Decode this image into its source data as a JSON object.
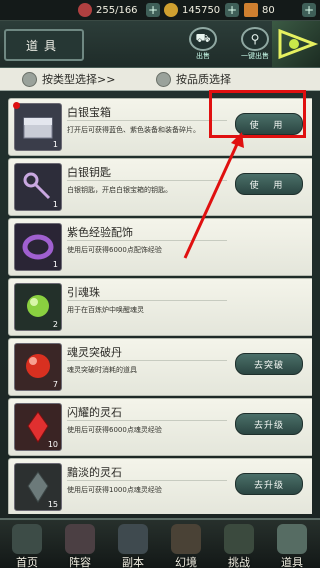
{
  "status": {
    "stamina": "255/166",
    "coins": "145750",
    "gems": "80"
  },
  "header": {
    "title": "道具",
    "sell_label": "出售",
    "batch_sell_label": "一键出售"
  },
  "filters": {
    "by_type": "按类型选择>>",
    "by_quality": "按品质选择"
  },
  "items": [
    {
      "name": "白银宝箱",
      "desc": "打开后可获得蓝色、紫色装备和装备碎片。",
      "qty": "1",
      "action": "使 用",
      "has_button": true
    },
    {
      "name": "白银钥匙",
      "desc": "白银钥匙，开启白银宝箱的钥匙。",
      "qty": "1",
      "action": "使 用",
      "has_button": true
    },
    {
      "name": "紫色经验配饰",
      "desc": "使用后可获得6000点配饰经验",
      "qty": "1",
      "action": "",
      "has_button": false
    },
    {
      "name": "引魂珠",
      "desc": "用于在百炼炉中唤醒魂灵",
      "qty": "2",
      "action": "",
      "has_button": false
    },
    {
      "name": "魂灵突破丹",
      "desc": "魂灵突破时消耗的道具",
      "qty": "7",
      "action": "去突破",
      "has_button": true
    },
    {
      "name": "闪耀的灵石",
      "desc": "使用后可获得6000点魂灵经验",
      "qty": "10",
      "action": "去升级",
      "has_button": true
    },
    {
      "name": "黯淡的灵石",
      "desc": "使用后可获得1000点魂灵经验",
      "qty": "15",
      "action": "去升级",
      "has_button": true
    }
  ],
  "nav": [
    {
      "label": "首页",
      "active": false
    },
    {
      "label": "阵容",
      "active": false
    },
    {
      "label": "副本",
      "active": false
    },
    {
      "label": "幻境",
      "active": false
    },
    {
      "label": "挑战",
      "active": false
    },
    {
      "label": "道具",
      "active": true
    }
  ],
  "colors": {
    "highlight": "#e01010",
    "arrow": "#e01010"
  }
}
